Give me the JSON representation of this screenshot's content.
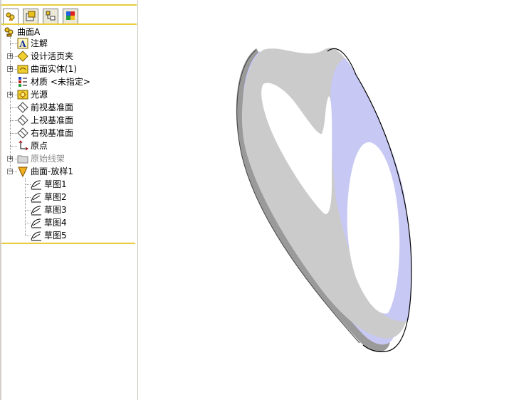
{
  "sidebar": {
    "tabs": [
      {
        "icon": "feature-manager-icon"
      },
      {
        "icon": "property-manager-icon"
      },
      {
        "icon": "configuration-manager-icon"
      },
      {
        "icon": "appearance-manager-icon"
      }
    ],
    "tree": {
      "root": {
        "label": "曲面A",
        "icon": "part-icon"
      },
      "items": [
        {
          "label": "注解",
          "icon": "annotations-icon",
          "expander": false
        },
        {
          "label": "设计活页夹",
          "icon": "design-binder-icon",
          "expander": true
        },
        {
          "label": "曲面实体(1)",
          "icon": "surface-bodies-icon",
          "expander": true
        },
        {
          "label": "材质 <未指定>",
          "icon": "material-icon",
          "expander": false
        },
        {
          "label": "光源",
          "icon": "lights-icon",
          "expander": true
        },
        {
          "label": "前视基准面",
          "icon": "plane-icon",
          "expander": false
        },
        {
          "label": "上视基准面",
          "icon": "plane-icon",
          "expander": false
        },
        {
          "label": "右视基准面",
          "icon": "plane-icon",
          "expander": false
        },
        {
          "label": "原点",
          "icon": "origin-icon",
          "expander": false
        },
        {
          "label": "原始线架",
          "icon": "folder-icon",
          "expander": true,
          "dimmed": true
        },
        {
          "label": "曲面-放样1",
          "icon": "loft-surface-icon",
          "expander": true,
          "expanded": true
        }
      ],
      "children": [
        {
          "label": "草图1",
          "icon": "sketch-icon"
        },
        {
          "label": "草图2",
          "icon": "sketch-icon"
        },
        {
          "label": "草图3",
          "icon": "sketch-icon"
        },
        {
          "label": "草图4",
          "icon": "sketch-icon"
        },
        {
          "label": "草图5",
          "icon": "sketch-icon"
        }
      ]
    }
  },
  "viewport": {
    "colors": {
      "surface_face": "#cbcbcb",
      "surface_shadow": "#9a9a9a",
      "surface_lavender": "#c8c8f5",
      "surface_edge": "#000000",
      "highlight": "#ffffff"
    }
  }
}
